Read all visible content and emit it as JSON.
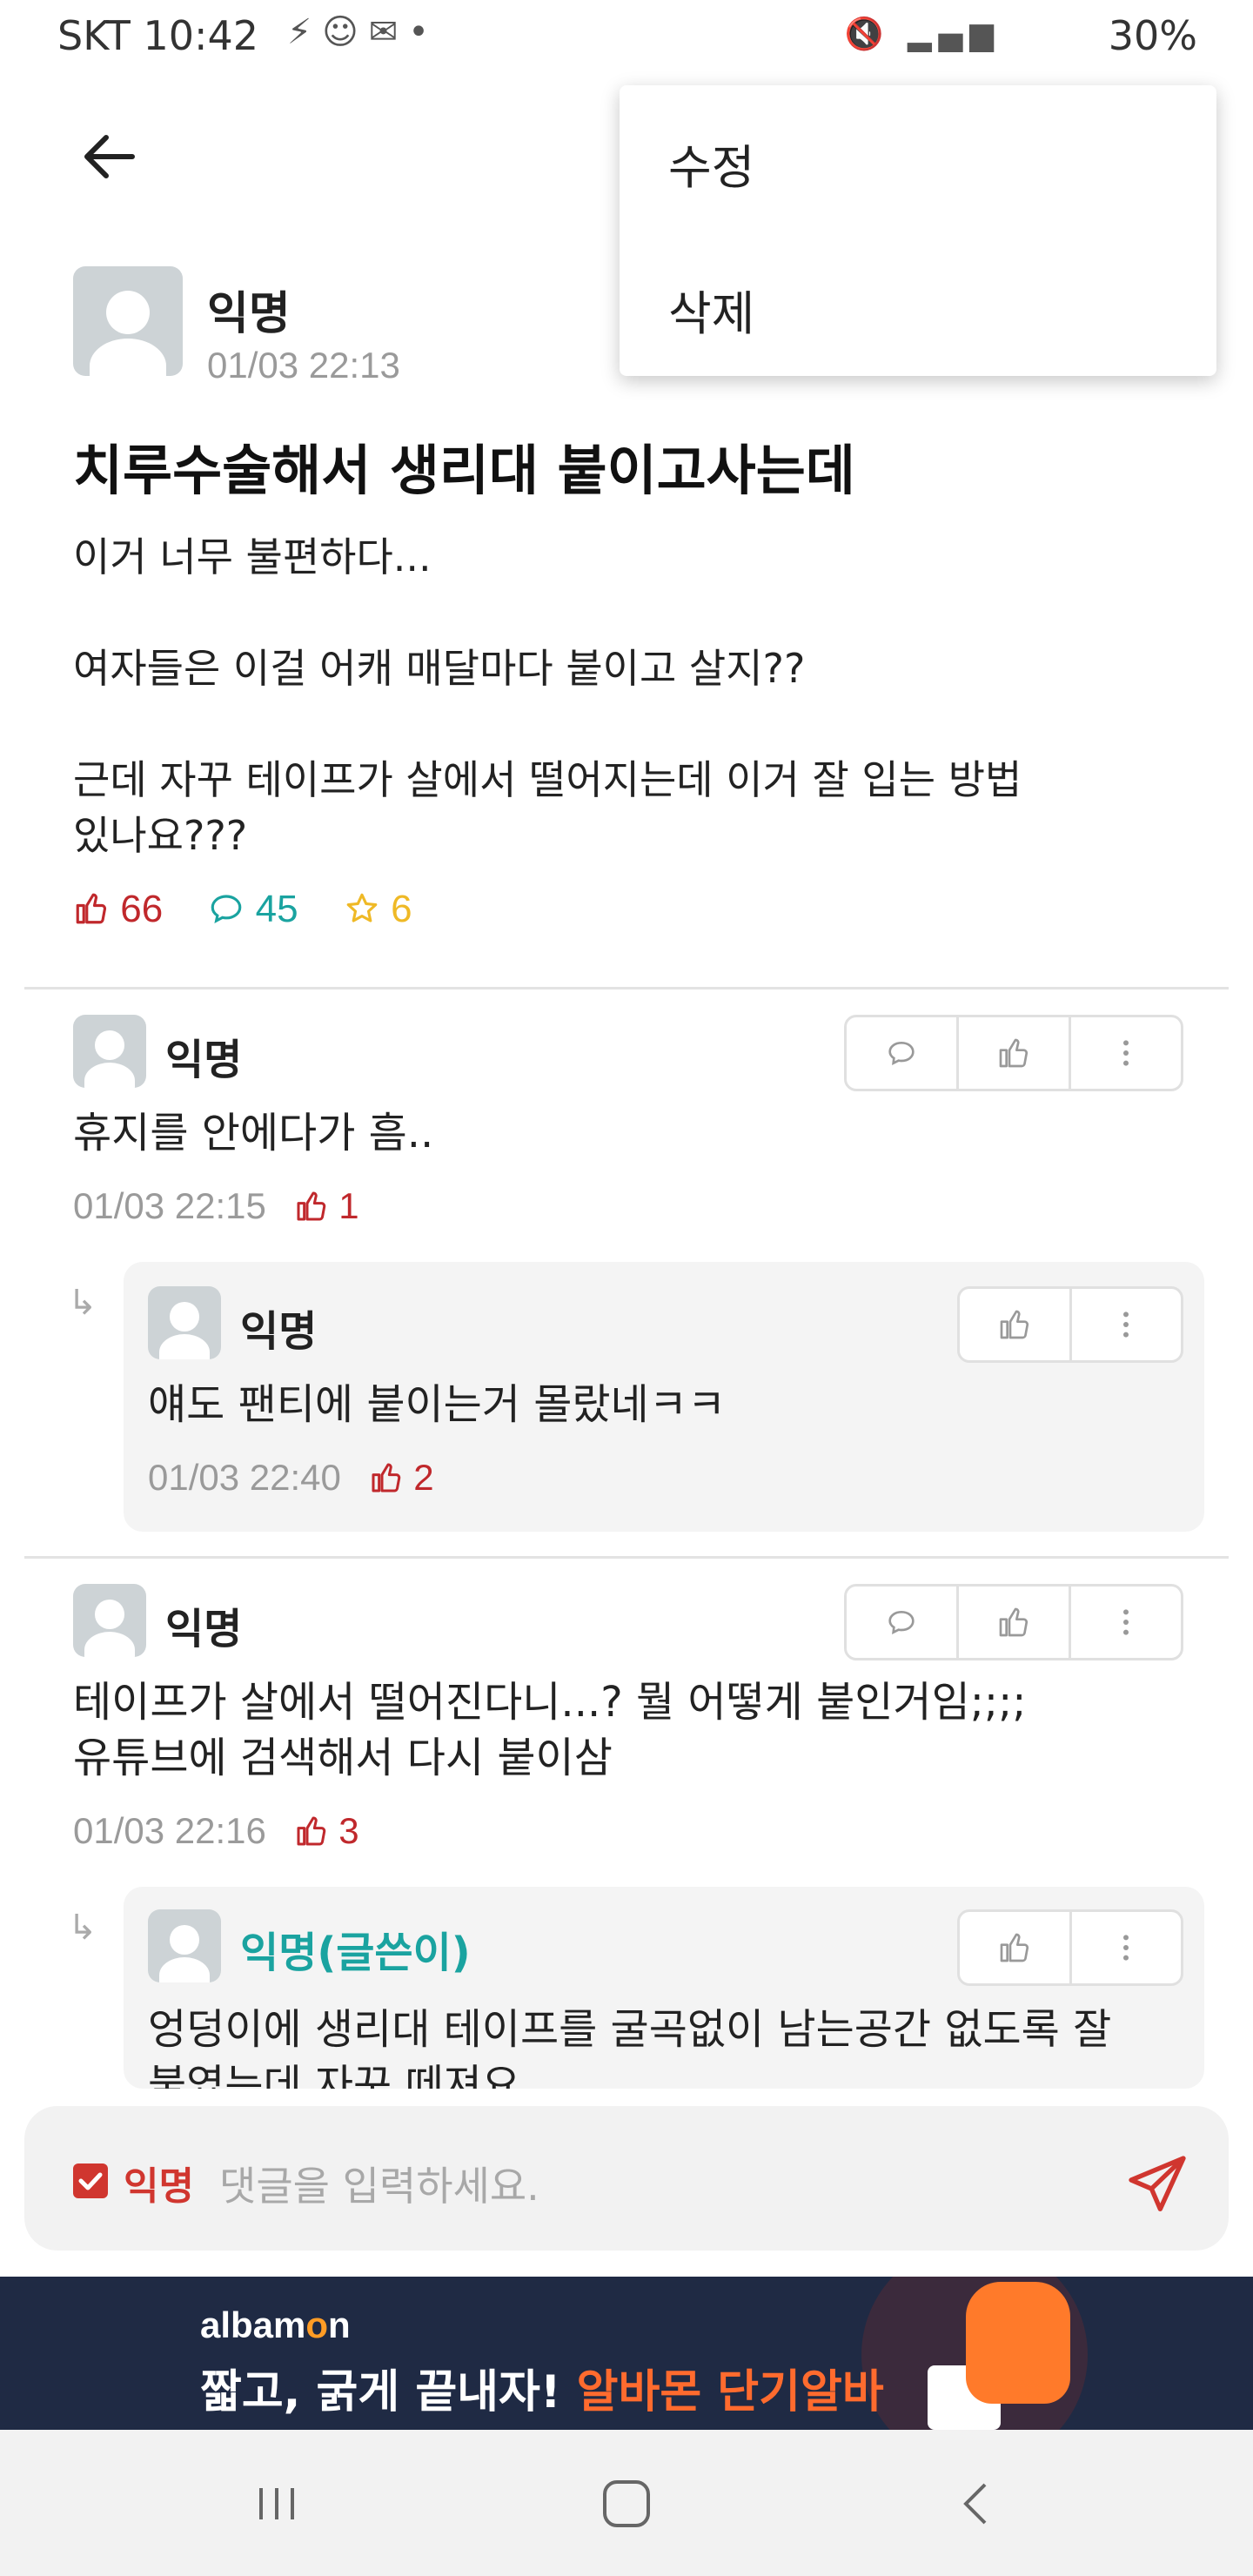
{
  "status": {
    "carrier_time": "SKT 10:42",
    "battery": "30%",
    "network": "LTE"
  },
  "menu": {
    "items": [
      "수정",
      "삭제"
    ]
  },
  "post": {
    "author": "익명",
    "time": "01/03 22:13",
    "title": "치루수술해서 생리대 붙이고사는데",
    "body": "이거 너무 불편하다...\n\n여자들은 이걸 어캐 매달마다 붙이고 살지??\n\n근데 자꾸 테이프가 살에서 떨어지는데 이거 잘 입는 방법\n있나요???",
    "likes": "66",
    "comments": "45",
    "scraps": "6"
  },
  "comments": [
    {
      "author": "익명",
      "text": "휴지를 안에다가 흠..",
      "time": "01/03 22:15",
      "likes": "1",
      "reply": {
        "author": "익명",
        "text": "얘도 팬티에 붙이는거 몰랐네ㅋㅋ",
        "time": "01/03 22:40",
        "likes": "2"
      }
    },
    {
      "author": "익명",
      "text": "테이프가 살에서 떨어진다니...? 뭘 어떻게 붙인거임;;;;\n유튜브에 검색해서 다시 붙이삼",
      "time": "01/03 22:16",
      "likes": "3",
      "reply": {
        "author": "익명(글쓴이)",
        "text": "엉덩이에 생리대 테이프를 굴곡없이 남는공간 없도록 잘\n붙였는데 자꾸 떼져요"
      }
    }
  ],
  "input": {
    "anon_label": "익명",
    "placeholder": "댓글을 입력하세요."
  },
  "ad": {
    "brand_pre": "albam",
    "brand_o": "o",
    "brand_post": "n",
    "slogan": "짧고, 굵게 끝내자!",
    "slogan_hl": "알바몬 단기알바"
  },
  "colors": {
    "accent": "#c0282c",
    "teal": "#1aa3a0",
    "star": "#efb926",
    "ad_bg": "#1f2a44"
  }
}
